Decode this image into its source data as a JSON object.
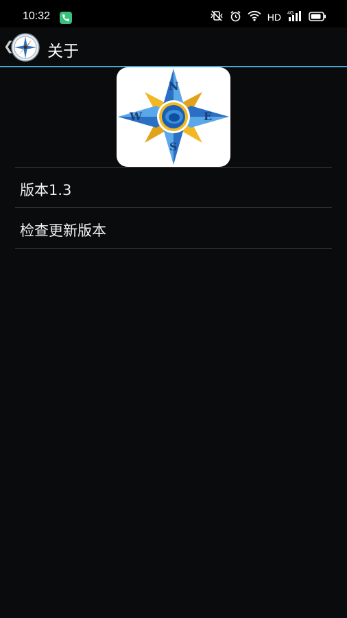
{
  "status_bar": {
    "time": "10:32",
    "network": "HD",
    "signal_type": "4G"
  },
  "header": {
    "title": "关于",
    "icons": [
      "back-chevron-icon",
      "compass-app-icon"
    ]
  },
  "logo": {
    "letters": {
      "n": "N",
      "s": "S",
      "e": "E",
      "w": "W"
    }
  },
  "list": {
    "items": [
      {
        "label": "版本1.3"
      },
      {
        "label": "检查更新版本"
      }
    ]
  },
  "colors": {
    "accent": "#4aa8d6",
    "background": "#0a0b0c",
    "divider": "#3a3d40"
  }
}
